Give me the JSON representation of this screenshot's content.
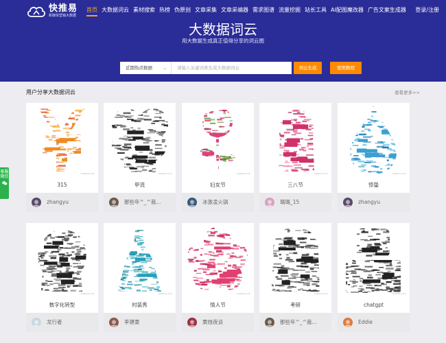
{
  "brand": {
    "name": "快推易",
    "slogan": "新媒体营销大数据"
  },
  "nav": [
    {
      "label": "首页",
      "active": true
    },
    {
      "label": "大数据词云"
    },
    {
      "label": "素材搜索"
    },
    {
      "label": "热榜"
    },
    {
      "label": "伪原创"
    },
    {
      "label": "文章采集"
    },
    {
      "label": "文章采编器"
    },
    {
      "label": "需求图谱"
    },
    {
      "label": "流量挖掘"
    },
    {
      "label": "站长工具"
    },
    {
      "label": "AI配图魔改器"
    },
    {
      "label": "广告文案生成器"
    }
  ],
  "auth_label": "登录/注册",
  "hero": {
    "title": "大数据词云",
    "subtitle": "用大数据生成真正值得分享的词云图"
  },
  "search": {
    "select_value": "近期热点数据",
    "placeholder": "请输入关键词来生成大数据词云",
    "generate_label": "词云生成",
    "tutorial_label": "使用教程"
  },
  "section": {
    "title": "用户分享大数据词云",
    "more_label": "查看更多>>"
  },
  "watermark": "kuaituiyi.com",
  "cards": [
    {
      "title": "315",
      "user": "zhangyu",
      "shape": "yen",
      "colors": [
        "#f08a24",
        "#e05a2b",
        "#f4b043"
      ],
      "avatar": "#5a4a6a"
    },
    {
      "title": "甲流",
      "user": "那些年^_^我...",
      "shape": "skull",
      "colors": [
        "#222222",
        "#555555",
        "#888888"
      ],
      "avatar": "#6b5a4a"
    },
    {
      "title": "妇女节",
      "user": "冰激凌火锅",
      "shape": "rose",
      "colors": [
        "#e0407a",
        "#c8326a",
        "#5aa83a"
      ],
      "avatar": "#3a5a7a"
    },
    {
      "title": "三八节",
      "user": "璐璐_15",
      "shape": "woman",
      "colors": [
        "#d0306a",
        "#a01e4e",
        "#f07aa0"
      ],
      "avatar": "#d8a0c0"
    },
    {
      "title": "惊蛰",
      "user": "zhangyu",
      "shape": "drop",
      "colors": [
        "#3aa0d0",
        "#1e7cb0",
        "#6cc4e8"
      ],
      "avatar": "#5a4a6a"
    },
    {
      "title": "数字化转型",
      "user": "龙行者",
      "shape": "head",
      "colors": [
        "#222222",
        "#444444",
        "#777777"
      ],
      "avatar": "#c8d8e0"
    },
    {
      "title": "时装秀",
      "user": "李建豪",
      "shape": "dress",
      "colors": [
        "#2aa0b8",
        "#1a7e96",
        "#58c0d0"
      ],
      "avatar": "#8a5a4a"
    },
    {
      "title": "情人节",
      "user": "栗烛夜谈",
      "shape": "flower",
      "colors": [
        "#e04070",
        "#f07098",
        "#c02858"
      ],
      "avatar": "#a03040"
    },
    {
      "title": "考研",
      "user": "那些年^_^我...",
      "shape": "owl",
      "colors": [
        "#222222",
        "#555555",
        "#888888"
      ],
      "avatar": "#6b5a4a"
    },
    {
      "title": "chatgpt",
      "user": "Eddie",
      "shape": "bot",
      "colors": [
        "#222222",
        "#444444",
        "#666666"
      ],
      "avatar": "#e07a3a"
    }
  ],
  "side_tab": {
    "label": "客服微信"
  }
}
